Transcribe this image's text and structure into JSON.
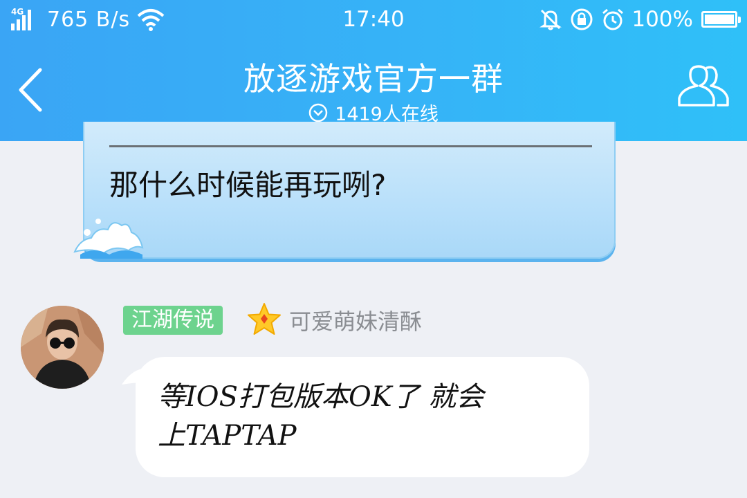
{
  "status_bar": {
    "network": "4G",
    "speed": "765 B/s",
    "time": "17:40",
    "battery": "100%"
  },
  "header": {
    "title": "放逐游戏官方一群",
    "online": "1419人在线"
  },
  "messages": [
    {
      "text": "那什么时候能再玩咧?"
    },
    {
      "badge": "江湖传说",
      "sender": "可爱萌妹清酥",
      "text_line1": "等IOS打包版本OK了 就会",
      "text_line2": "上TAPTAP"
    }
  ],
  "colors": {
    "header_blue": "#36b3f7",
    "badge_green": "#6dd38e",
    "chat_bg": "#eef0f5"
  }
}
